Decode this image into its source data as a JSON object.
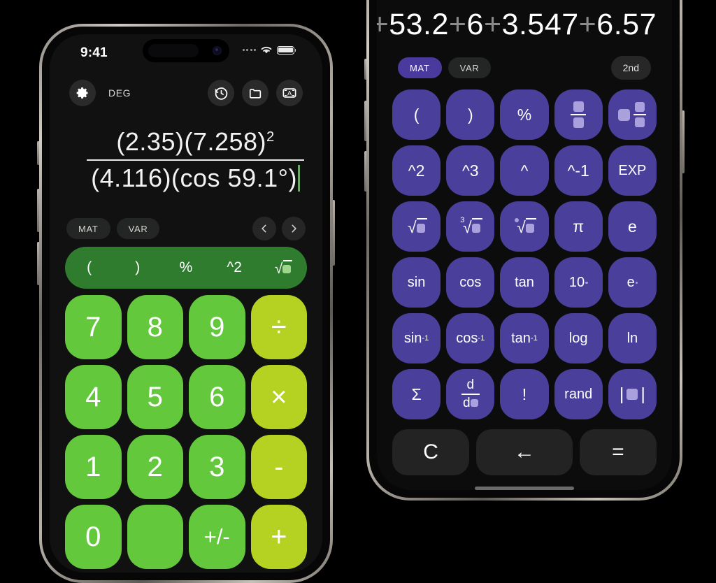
{
  "scene": {
    "background": "#000000",
    "description": "Two iPhone mockups showing a scientific calculator app"
  },
  "left_phone": {
    "theme_accent": "#63c83c",
    "status_bar": {
      "time": "9:41",
      "signal_icon": "cellular-dots-icon",
      "wifi_icon": "wifi-icon",
      "battery_icon": "battery-icon"
    },
    "toolbar": {
      "settings_icon": "gear-icon",
      "angle_mode": "DEG",
      "history_icon": "history-clock-icon",
      "folder_icon": "folder-icon",
      "keyboard_icon": "alpha-keyboard-icon"
    },
    "display": {
      "numerator": "(2.35)(7.258)",
      "numerator_exponent": "2",
      "denominator": "(4.116)(cos 59.1°)",
      "cursor_color": "#6ea86a"
    },
    "tabs": [
      {
        "label": "MAT",
        "active": false
      },
      {
        "label": "VAR",
        "active": false
      }
    ],
    "nav": {
      "prev_icon": "chevron-left-icon",
      "next_icon": "chevron-right-icon"
    },
    "function_strip": {
      "color": "#2f7c2f",
      "keys": [
        {
          "label": "(",
          "name": "paren-open"
        },
        {
          "label": ")",
          "name": "paren-close"
        },
        {
          "label": "%",
          "name": "percent"
        },
        {
          "label": "^2",
          "name": "square"
        },
        {
          "label": "√",
          "name": "square-root"
        }
      ]
    },
    "numpad": {
      "digit_color": "#63c83c",
      "operator_color": "#b5d122",
      "rows": [
        [
          {
            "label": "7",
            "type": "digit"
          },
          {
            "label": "8",
            "type": "digit"
          },
          {
            "label": "9",
            "type": "digit"
          },
          {
            "label": "÷",
            "type": "operator"
          }
        ],
        [
          {
            "label": "4",
            "type": "digit"
          },
          {
            "label": "5",
            "type": "digit"
          },
          {
            "label": "6",
            "type": "digit"
          },
          {
            "label": "×",
            "type": "operator"
          }
        ],
        [
          {
            "label": "1",
            "type": "digit"
          },
          {
            "label": "2",
            "type": "digit"
          },
          {
            "label": "3",
            "type": "digit"
          },
          {
            "label": "-",
            "type": "operator"
          }
        ],
        [
          {
            "label": "0",
            "type": "digit"
          },
          {
            "label": "",
            "type": "digit"
          },
          {
            "label": "+/-",
            "type": "digit"
          },
          {
            "label": "+",
            "type": "operator"
          }
        ]
      ]
    }
  },
  "right_phone": {
    "theme_accent": "#4a3f9b",
    "display": {
      "expression": "+53.2+6+3.547+6.57",
      "tokens": [
        {
          "text": "+",
          "dim": true
        },
        {
          "text": "53.2",
          "dim": false
        },
        {
          "text": "+",
          "dim": true
        },
        {
          "text": "6",
          "dim": false
        },
        {
          "text": "+",
          "dim": true
        },
        {
          "text": "3.547",
          "dim": false
        },
        {
          "text": "+",
          "dim": true
        },
        {
          "text": "6.57",
          "dim": false
        }
      ],
      "cursor_color": "#e0448c"
    },
    "tabs": [
      {
        "label": "MAT",
        "active": true
      },
      {
        "label": "VAR",
        "active": false
      }
    ],
    "second_key": "2nd",
    "keypad_rows": [
      [
        {
          "label": "(",
          "name": "paren-open",
          "icon": null
        },
        {
          "label": ")",
          "name": "paren-close",
          "icon": null
        },
        {
          "label": "%",
          "name": "percent",
          "icon": null
        },
        {
          "label": "",
          "name": "fraction",
          "icon": "fraction-icon"
        },
        {
          "label": "",
          "name": "mixed-fraction",
          "icon": "mixed-fraction-icon"
        }
      ],
      [
        {
          "label": "^2",
          "name": "square",
          "icon": null
        },
        {
          "label": "^3",
          "name": "cube",
          "icon": null
        },
        {
          "label": "^",
          "name": "power",
          "icon": null
        },
        {
          "label": "^-1",
          "name": "reciprocal",
          "icon": null
        },
        {
          "label": "EXP",
          "name": "exponent",
          "icon": null
        }
      ],
      [
        {
          "label": "",
          "name": "square-root",
          "icon": "sqrt-icon"
        },
        {
          "label": "",
          "name": "cube-root",
          "icon": "cbrt-icon"
        },
        {
          "label": "",
          "name": "nth-root",
          "icon": "nthroot-icon"
        },
        {
          "label": "π",
          "name": "pi",
          "icon": null
        },
        {
          "label": "e",
          "name": "euler",
          "icon": null
        }
      ],
      [
        {
          "label": "sin",
          "name": "sine",
          "icon": null
        },
        {
          "label": "cos",
          "name": "cosine",
          "icon": null
        },
        {
          "label": "tan",
          "name": "tangent",
          "icon": null
        },
        {
          "label": "10",
          "name": "ten-power",
          "icon": "power-placeholder"
        },
        {
          "label": "e",
          "name": "e-power",
          "icon": "power-placeholder"
        }
      ],
      [
        {
          "label": "sin",
          "name": "arcsine",
          "icon": "inverse-sup"
        },
        {
          "label": "cos",
          "name": "arccosine",
          "icon": "inverse-sup"
        },
        {
          "label": "tan",
          "name": "arctangent",
          "icon": "inverse-sup"
        },
        {
          "label": "log",
          "name": "log",
          "icon": null
        },
        {
          "label": "ln",
          "name": "natural-log",
          "icon": null
        }
      ],
      [
        {
          "label": "Σ",
          "name": "summation",
          "icon": null
        },
        {
          "label": "",
          "name": "derivative",
          "icon": "derivative-icon"
        },
        {
          "label": "!",
          "name": "factorial",
          "icon": null
        },
        {
          "label": "rand",
          "name": "random",
          "icon": null
        },
        {
          "label": "",
          "name": "absolute-value",
          "icon": "abs-icon"
        }
      ]
    ],
    "bottom_bar": [
      {
        "label": "C",
        "name": "clear"
      },
      {
        "label": "←",
        "name": "backspace"
      },
      {
        "label": "=",
        "name": "equals"
      }
    ]
  }
}
